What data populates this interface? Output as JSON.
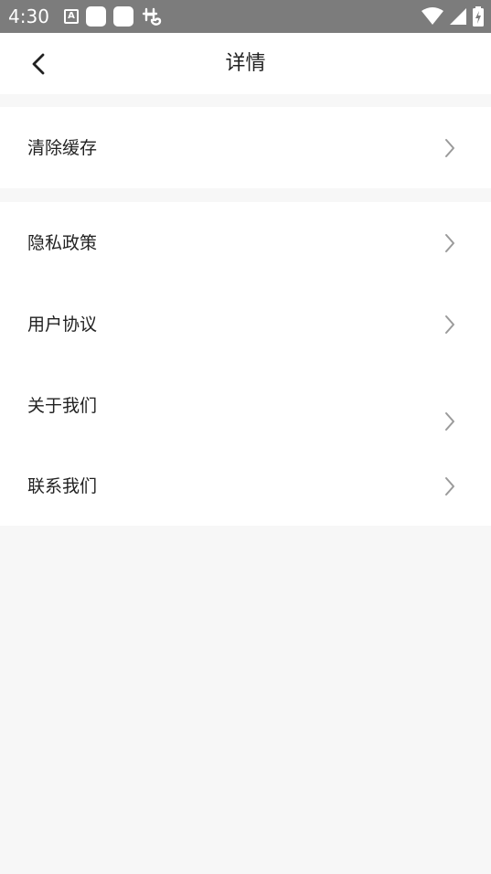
{
  "status_bar": {
    "time": "4:30",
    "left_icons": [
      "a-icon",
      "square-icon",
      "square-icon",
      "bug-icon"
    ],
    "right_icons": [
      "wifi-icon",
      "signal-icon",
      "battery-charging-icon"
    ]
  },
  "app_bar": {
    "back_icon": "chevron-left-icon",
    "title": "详情"
  },
  "groups": [
    {
      "items": [
        {
          "label": "清除缓存",
          "icon": "chevron-right-icon"
        }
      ]
    },
    {
      "items": [
        {
          "label": "隐私政策",
          "icon": "chevron-right-icon"
        },
        {
          "label": "用户协议",
          "icon": "chevron-right-icon"
        },
        {
          "label": "关于我们",
          "icon": "chevron-right-icon"
        },
        {
          "label": "联系我们",
          "icon": "chevron-right-icon"
        }
      ]
    }
  ],
  "colors": {
    "status_bar_bg": "#7c7c7c",
    "page_bg": "#f7f7f7",
    "card_bg": "#ffffff",
    "text": "#222222",
    "chevron": "#9a9a9a"
  }
}
